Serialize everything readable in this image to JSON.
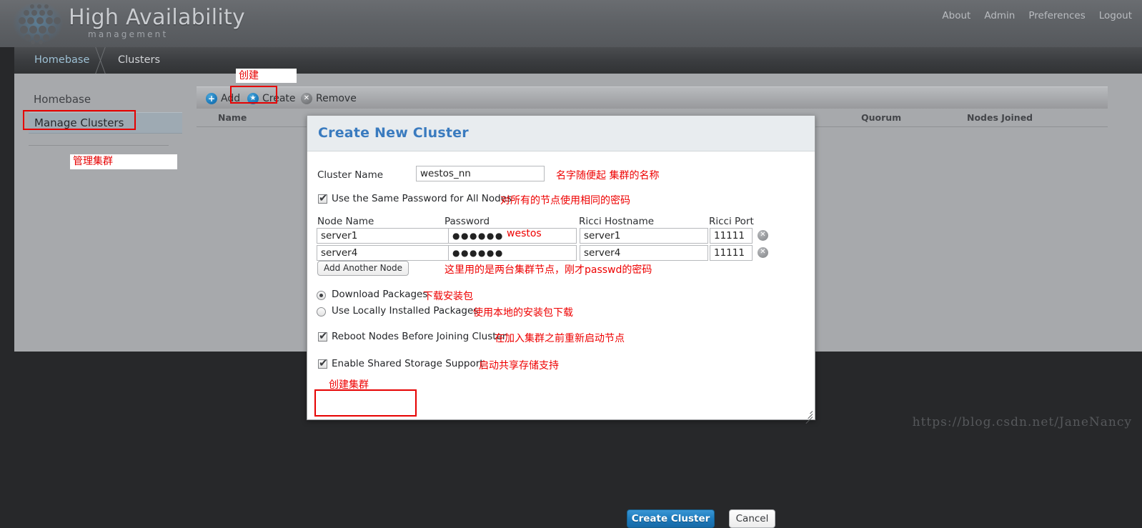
{
  "header": {
    "brand": "High Availability",
    "brand_sub": "management",
    "nav": [
      {
        "label": "About"
      },
      {
        "label": "Admin"
      },
      {
        "label": "Preferences"
      },
      {
        "label": "Logout"
      }
    ],
    "logo_icon": "dot-cluster-logo-icon"
  },
  "breadcrumb": {
    "items": [
      {
        "label": "Homebase"
      },
      {
        "label": "Clusters"
      }
    ]
  },
  "sidebar": {
    "items": [
      {
        "label": "Homebase",
        "selected": false
      },
      {
        "label": "Manage Clusters",
        "selected": true
      }
    ]
  },
  "toolbar": {
    "buttons": [
      {
        "label": "Add",
        "icon": "plus-circle-icon",
        "glyph": "+"
      },
      {
        "label": "Create",
        "icon": "star-circle-icon",
        "glyph": "★"
      },
      {
        "label": "Remove",
        "icon": "x-circle-icon",
        "glyph": "✕"
      }
    ]
  },
  "table": {
    "columns": [
      {
        "label": "Name"
      },
      {
        "label": "Quorum"
      },
      {
        "label": "Nodes Joined"
      }
    ]
  },
  "dialog": {
    "title": "Create New Cluster",
    "cluster_name": {
      "label": "Cluster Name",
      "value": "westos_nn"
    },
    "same_password": {
      "label": "Use the Same Password for All Nodes",
      "checked": true
    },
    "node_table": {
      "columns": [
        {
          "label": "Node Name"
        },
        {
          "label": "Password"
        },
        {
          "label": "Ricci Hostname"
        },
        {
          "label": "Ricci Port"
        }
      ],
      "rows": [
        {
          "node_name": "server1",
          "password": "●●●●●●",
          "ricci_hostname": "server1",
          "ricci_port": "11111"
        },
        {
          "node_name": "server4",
          "password": "●●●●●●",
          "ricci_hostname": "server4",
          "ricci_port": "11111"
        }
      ],
      "add_node_label": "Add Another Node",
      "delete_icon": "delete-row-icon"
    },
    "package_source": {
      "options": [
        {
          "label": "Download Packages",
          "selected": true
        },
        {
          "label": "Use Locally Installed Packages",
          "selected": false
        }
      ]
    },
    "reboot_nodes": {
      "label": "Reboot Nodes Before Joining Cluster",
      "checked": true
    },
    "shared_storage": {
      "label": "Enable Shared Storage Support",
      "checked": true
    },
    "create_button": "Create Cluster",
    "cancel_button": "Cancel",
    "resize_handle_icon": "resize-grip-icon"
  },
  "annotations": [
    {
      "id": "a_create",
      "text": "创建"
    },
    {
      "id": "a_manage",
      "text": "管理集群"
    },
    {
      "id": "a_name",
      "text": "名字随便起 集群的名称"
    },
    {
      "id": "a_samepwd",
      "text": "对所有的节点使用相同的密码"
    },
    {
      "id": "a_westos",
      "text": "westos"
    },
    {
      "id": "a_nodes",
      "text": "这里用的是两台集群节点，刚才passwd的密码"
    },
    {
      "id": "a_download",
      "text": "下载安装包"
    },
    {
      "id": "a_local",
      "text": "使用本地的安装包下载"
    },
    {
      "id": "a_reboot",
      "text": "在加入集群之前重新启动节点"
    },
    {
      "id": "a_storage",
      "text": "启动共享存储支持"
    },
    {
      "id": "a_createcluster",
      "text": "创建集群"
    }
  ],
  "watermark": "https://blog.csdn.net/JaneNancy",
  "colors": {
    "accent_blue": "#1d7bbd",
    "annotation_red": "#ee0000",
    "panel_gray": "#a7a9ac",
    "page_dark": "#27282a"
  }
}
